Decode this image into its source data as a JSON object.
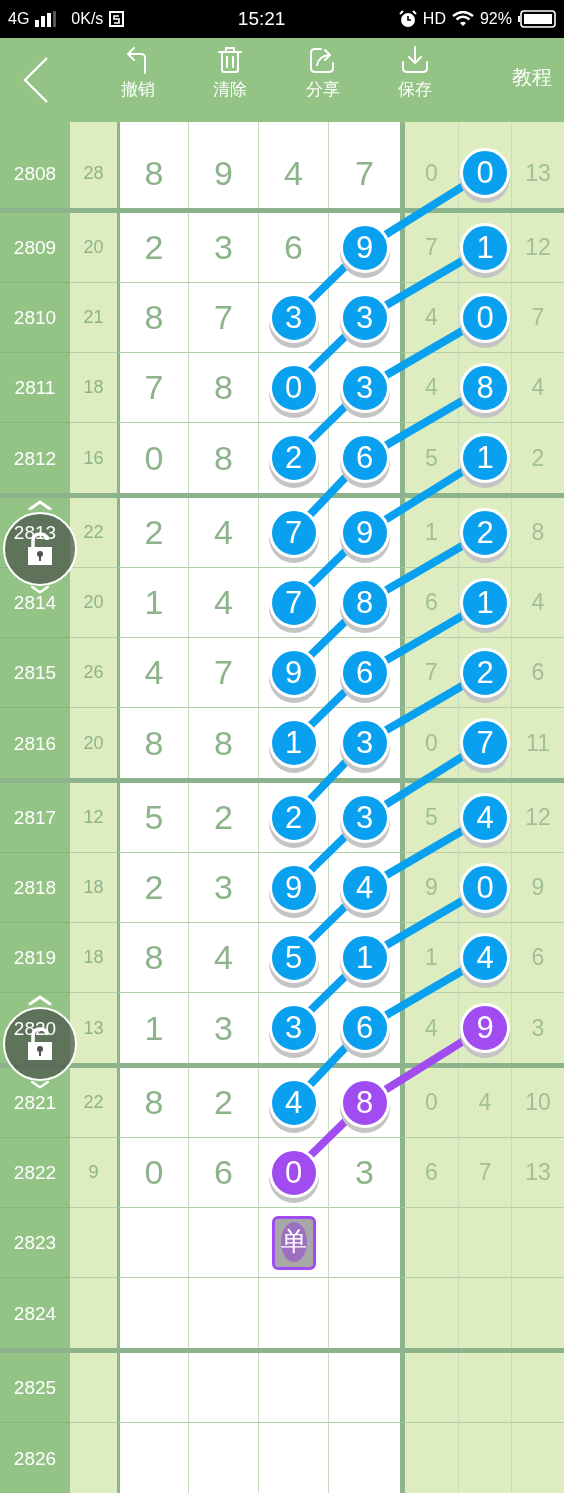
{
  "status_bar": {
    "network": "4G",
    "speed": "0K/s",
    "time": "15:21",
    "hd": "HD",
    "battery": "92%"
  },
  "toolbar": {
    "actions": [
      {
        "kind": "undo",
        "label": "撤销"
      },
      {
        "kind": "delete",
        "label": "清除"
      },
      {
        "kind": "share",
        "label": "分享"
      },
      {
        "kind": "save",
        "label": "保存"
      }
    ],
    "tutorial": "教程"
  },
  "groups": [
    {
      "rows": [
        {
          "issue": "2808",
          "sum": "28",
          "digits": [
            {
              "kind": "plain",
              "text": "8"
            },
            {
              "kind": "plain",
              "text": "9"
            },
            {
              "kind": "plain",
              "text": "4"
            },
            {
              "kind": "plain",
              "text": "7"
            }
          ],
          "right": [
            {
              "kind": "plain",
              "text": "0"
            },
            {
              "kind": "ball",
              "text": "0",
              "color": "#0aa0f0"
            },
            {
              "kind": "plain",
              "text": "13"
            }
          ]
        }
      ]
    },
    {
      "rows": [
        {
          "issue": "2809",
          "sum": "20",
          "digits": [
            {
              "kind": "plain",
              "text": "2"
            },
            {
              "kind": "plain",
              "text": "3"
            },
            {
              "kind": "plain",
              "text": "6"
            },
            {
              "kind": "ball",
              "text": "9",
              "color": "#0aa0f0"
            }
          ],
          "right": [
            {
              "kind": "plain",
              "text": "7"
            },
            {
              "kind": "ball",
              "text": "1",
              "color": "#0aa0f0"
            },
            {
              "kind": "plain",
              "text": "12"
            }
          ]
        },
        {
          "issue": "2810",
          "sum": "21",
          "digits": [
            {
              "kind": "plain",
              "text": "8"
            },
            {
              "kind": "plain",
              "text": "7"
            },
            {
              "kind": "ball",
              "text": "3",
              "color": "#0aa0f0"
            },
            {
              "kind": "ball",
              "text": "3",
              "color": "#0aa0f0"
            }
          ],
          "right": [
            {
              "kind": "plain",
              "text": "4"
            },
            {
              "kind": "ball",
              "text": "0",
              "color": "#0aa0f0"
            },
            {
              "kind": "plain",
              "text": "7"
            }
          ]
        },
        {
          "issue": "2811",
          "sum": "18",
          "digits": [
            {
              "kind": "plain",
              "text": "7"
            },
            {
              "kind": "plain",
              "text": "8"
            },
            {
              "kind": "ball",
              "text": "0",
              "color": "#0aa0f0"
            },
            {
              "kind": "ball",
              "text": "3",
              "color": "#0aa0f0"
            }
          ],
          "right": [
            {
              "kind": "plain",
              "text": "4"
            },
            {
              "kind": "ball",
              "text": "8",
              "color": "#0aa0f0"
            },
            {
              "kind": "plain",
              "text": "4"
            }
          ]
        },
        {
          "issue": "2812",
          "sum": "16",
          "digits": [
            {
              "kind": "plain",
              "text": "0"
            },
            {
              "kind": "plain",
              "text": "8"
            },
            {
              "kind": "ball",
              "text": "2",
              "color": "#0aa0f0"
            },
            {
              "kind": "ball",
              "text": "6",
              "color": "#0aa0f0"
            }
          ],
          "right": [
            {
              "kind": "plain",
              "text": "5"
            },
            {
              "kind": "ball",
              "text": "1",
              "color": "#0aa0f0"
            },
            {
              "kind": "plain",
              "text": "2"
            }
          ]
        }
      ]
    },
    {
      "rows": [
        {
          "issue": "2813",
          "sum": "22",
          "lock": {
            "locked": false
          },
          "digits": [
            {
              "kind": "plain",
              "text": "2"
            },
            {
              "kind": "plain",
              "text": "4"
            },
            {
              "kind": "ball",
              "text": "7",
              "color": "#0aa0f0"
            },
            {
              "kind": "ball",
              "text": "9",
              "color": "#0aa0f0"
            }
          ],
          "right": [
            {
              "kind": "plain",
              "text": "1"
            },
            {
              "kind": "ball",
              "text": "2",
              "color": "#0aa0f0"
            },
            {
              "kind": "plain",
              "text": "8"
            }
          ]
        },
        {
          "issue": "2814",
          "sum": "20",
          "digits": [
            {
              "kind": "plain",
              "text": "1"
            },
            {
              "kind": "plain",
              "text": "4"
            },
            {
              "kind": "ball",
              "text": "7",
              "color": "#0aa0f0"
            },
            {
              "kind": "ball",
              "text": "8",
              "color": "#0aa0f0"
            }
          ],
          "right": [
            {
              "kind": "plain",
              "text": "6"
            },
            {
              "kind": "ball",
              "text": "1",
              "color": "#0aa0f0"
            },
            {
              "kind": "plain",
              "text": "4"
            }
          ]
        },
        {
          "issue": "2815",
          "sum": "26",
          "digits": [
            {
              "kind": "plain",
              "text": "4"
            },
            {
              "kind": "plain",
              "text": "7"
            },
            {
              "kind": "ball",
              "text": "9",
              "color": "#0aa0f0"
            },
            {
              "kind": "ball",
              "text": "6",
              "color": "#0aa0f0"
            }
          ],
          "right": [
            {
              "kind": "plain",
              "text": "7"
            },
            {
              "kind": "ball",
              "text": "2",
              "color": "#0aa0f0"
            },
            {
              "kind": "plain",
              "text": "6"
            }
          ]
        },
        {
          "issue": "2816",
          "sum": "20",
          "digits": [
            {
              "kind": "plain",
              "text": "8"
            },
            {
              "kind": "plain",
              "text": "8"
            },
            {
              "kind": "ball",
              "text": "1",
              "color": "#0aa0f0"
            },
            {
              "kind": "ball",
              "text": "3",
              "color": "#0aa0f0"
            }
          ],
          "right": [
            {
              "kind": "plain",
              "text": "0"
            },
            {
              "kind": "ball",
              "text": "7",
              "color": "#0aa0f0"
            },
            {
              "kind": "plain",
              "text": "11"
            }
          ]
        }
      ]
    },
    {
      "rows": [
        {
          "issue": "2817",
          "sum": "12",
          "digits": [
            {
              "kind": "plain",
              "text": "5"
            },
            {
              "kind": "plain",
              "text": "2"
            },
            {
              "kind": "ball",
              "text": "2",
              "color": "#0aa0f0"
            },
            {
              "kind": "ball",
              "text": "3",
              "color": "#0aa0f0"
            }
          ],
          "right": [
            {
              "kind": "plain",
              "text": "5"
            },
            {
              "kind": "ball",
              "text": "4",
              "color": "#0aa0f0"
            },
            {
              "kind": "plain",
              "text": "12"
            }
          ]
        },
        {
          "issue": "2818",
          "sum": "18",
          "digits": [
            {
              "kind": "plain",
              "text": "2"
            },
            {
              "kind": "plain",
              "text": "3"
            },
            {
              "kind": "ball",
              "text": "9",
              "color": "#0aa0f0"
            },
            {
              "kind": "ball",
              "text": "4",
              "color": "#0aa0f0"
            }
          ],
          "right": [
            {
              "kind": "plain",
              "text": "9"
            },
            {
              "kind": "ball",
              "text": "0",
              "color": "#0aa0f0"
            },
            {
              "kind": "plain",
              "text": "9"
            }
          ]
        },
        {
          "issue": "2819",
          "sum": "18",
          "digits": [
            {
              "kind": "plain",
              "text": "8"
            },
            {
              "kind": "plain",
              "text": "4"
            },
            {
              "kind": "ball",
              "text": "5",
              "color": "#0aa0f0"
            },
            {
              "kind": "ball",
              "text": "1",
              "color": "#0aa0f0"
            }
          ],
          "right": [
            {
              "kind": "plain",
              "text": "1"
            },
            {
              "kind": "ball",
              "text": "4",
              "color": "#0aa0f0"
            },
            {
              "kind": "plain",
              "text": "6"
            }
          ]
        },
        {
          "issue": "2820",
          "sum": "13",
          "lock": {
            "locked": false
          },
          "digits": [
            {
              "kind": "plain",
              "text": "1"
            },
            {
              "kind": "plain",
              "text": "3"
            },
            {
              "kind": "ball",
              "text": "3",
              "color": "#0aa0f0"
            },
            {
              "kind": "ball",
              "text": "6",
              "color": "#0aa0f0"
            }
          ],
          "right": [
            {
              "kind": "plain",
              "text": "4"
            },
            {
              "kind": "ball",
              "text": "9",
              "color": "#a04cf0"
            },
            {
              "kind": "plain",
              "text": "3"
            }
          ]
        }
      ]
    },
    {
      "rows": [
        {
          "issue": "2821",
          "sum": "22",
          "digits": [
            {
              "kind": "plain",
              "text": "8"
            },
            {
              "kind": "plain",
              "text": "2"
            },
            {
              "kind": "ball",
              "text": "4",
              "color": "#0aa0f0"
            },
            {
              "kind": "ball",
              "text": "8",
              "color": "#a04cf0"
            }
          ],
          "right": [
            {
              "kind": "plain",
              "text": "0"
            },
            {
              "kind": "plain",
              "text": "4"
            },
            {
              "kind": "plain",
              "text": "10"
            }
          ]
        },
        {
          "issue": "2822",
          "sum": "9",
          "digits": [
            {
              "kind": "plain",
              "text": "0"
            },
            {
              "kind": "plain",
              "text": "6"
            },
            {
              "kind": "ball",
              "text": "0",
              "color": "#a04cf0"
            },
            {
              "kind": "plain",
              "text": "3"
            }
          ],
          "right": [
            {
              "kind": "plain",
              "text": "6"
            },
            {
              "kind": "plain",
              "text": "7"
            },
            {
              "kind": "plain",
              "text": "13"
            }
          ]
        },
        {
          "issue": "2823",
          "marker": {
            "kind": "button",
            "text": "单",
            "color": "#a04cf0"
          }
        },
        {
          "issue": "2824"
        }
      ]
    },
    {
      "rows": [
        {
          "issue": "2825"
        },
        {
          "issue": "2826"
        }
      ]
    }
  ]
}
